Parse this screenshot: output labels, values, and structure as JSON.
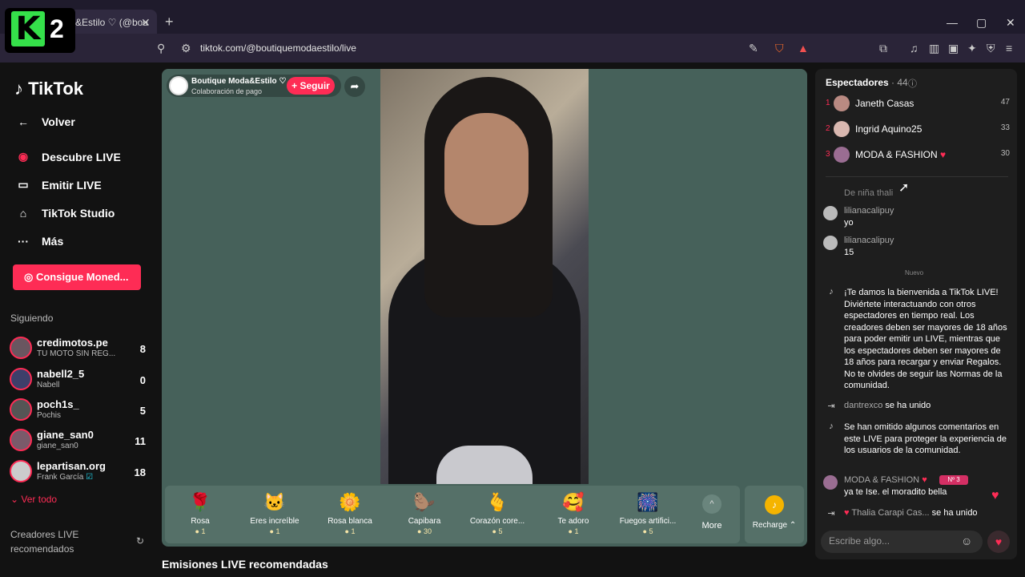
{
  "browser": {
    "tab_title": "&Estilo ♡ (@bou",
    "url": "tiktok.com/@boutiquemodaestilo/live"
  },
  "overlay_logo": {
    "letter": "K",
    "number": "2"
  },
  "sidebar": {
    "brand": "TikTok",
    "nav": [
      {
        "label": "Volver",
        "icon": "back-arrow-icon"
      },
      {
        "label": "Descubre LIVE",
        "icon": "live-icon"
      },
      {
        "label": "Emitir LIVE",
        "icon": "camera-icon"
      },
      {
        "label": "TikTok Studio",
        "icon": "studio-icon"
      },
      {
        "label": "Más",
        "icon": "more-icon"
      }
    ],
    "coins_button": "Consigue Moned...",
    "following_title": "Siguiendo",
    "following": [
      {
        "name": "credimotos.pe",
        "sub": "TU MOTO SIN REG...",
        "count": "8"
      },
      {
        "name": "nabell2_5",
        "sub": "Nabell",
        "count": "0"
      },
      {
        "name": "poch1s_",
        "sub": "Pochis",
        "count": "5"
      },
      {
        "name": "giane_san0",
        "sub": "giane_san0",
        "count": "11"
      },
      {
        "name": "lepartisan.org",
        "sub": "Frank García",
        "count": "18"
      }
    ],
    "see_all": "Ver todo",
    "creators_title": "Creadores LIVE recomendados"
  },
  "stream": {
    "host_name": "Boutique Moda&Estilo ♡",
    "host_sub": "Colaboración de pago",
    "follow_label": "+ Seguir",
    "gifts": [
      {
        "name": "Rosa",
        "cost": "1",
        "icon": "rose-icon",
        "glyph": "🌹"
      },
      {
        "name": "Eres increíble",
        "cost": "1",
        "icon": "cat-icon",
        "glyph": "🐱"
      },
      {
        "name": "Rosa blanca",
        "cost": "1",
        "icon": "white-rose-icon",
        "glyph": "🌼"
      },
      {
        "name": "Capibara",
        "cost": "30",
        "icon": "capybara-icon",
        "glyph": "🦫"
      },
      {
        "name": "Corazón core...",
        "cost": "5",
        "icon": "finger-heart-icon",
        "glyph": "🫰"
      },
      {
        "name": "Te adoro",
        "cost": "1",
        "icon": "heart-face-icon",
        "glyph": "🥰"
      },
      {
        "name": "Fuegos artifici...",
        "cost": "5",
        "icon": "fireworks-icon",
        "glyph": "🎆"
      }
    ],
    "more_label": "More",
    "recharge_label": "Recharge",
    "recommended_title": "Emisiones LIVE recomendadas"
  },
  "panel": {
    "viewers_title": "Espectadores",
    "viewers_count": "· 44",
    "top": [
      {
        "rank": "1",
        "name": "Janeth Casas",
        "score": "47"
      },
      {
        "rank": "2",
        "name": "Ingrid Aquino25",
        "score": "33"
      },
      {
        "rank": "3",
        "name": "MODA & FASHION",
        "score": "30"
      }
    ],
    "faded_text": "De niña thali",
    "new_marker": "Nuevo",
    "chat": [
      {
        "user": "lilianacalipuy",
        "text": "yo"
      },
      {
        "user": "lilianacalipuy",
        "text": "15"
      },
      {
        "user": "",
        "text": "¡Te damos la bienvenida a TikTok LIVE! Diviértete interactuando con otros espectadores en tiempo real. Los creadores deben ser mayores de 18 años para poder emitir un LIVE, mientras que los espectadores deben ser mayores de 18 años para recargar y enviar Regalos. No te olvides de seguir las Normas de la comunidad."
      },
      {
        "user": "dantrexco",
        "text": "se ha unido"
      },
      {
        "user": "",
        "text": "Se han omitido algunos comentarios en este LIVE para proteger la experiencia de los usuarios de la comunidad."
      },
      {
        "user": "MODA & FASHION",
        "text": "ya te Ise. el moradito bella"
      },
      {
        "user": "Thalia Carapi Cas...",
        "text": "se ha unido"
      }
    ],
    "badge": "Nº 3",
    "input_placeholder": "Escribe algo..."
  },
  "colors": {
    "accent": "#fe2c55",
    "stage": "#46615a"
  }
}
